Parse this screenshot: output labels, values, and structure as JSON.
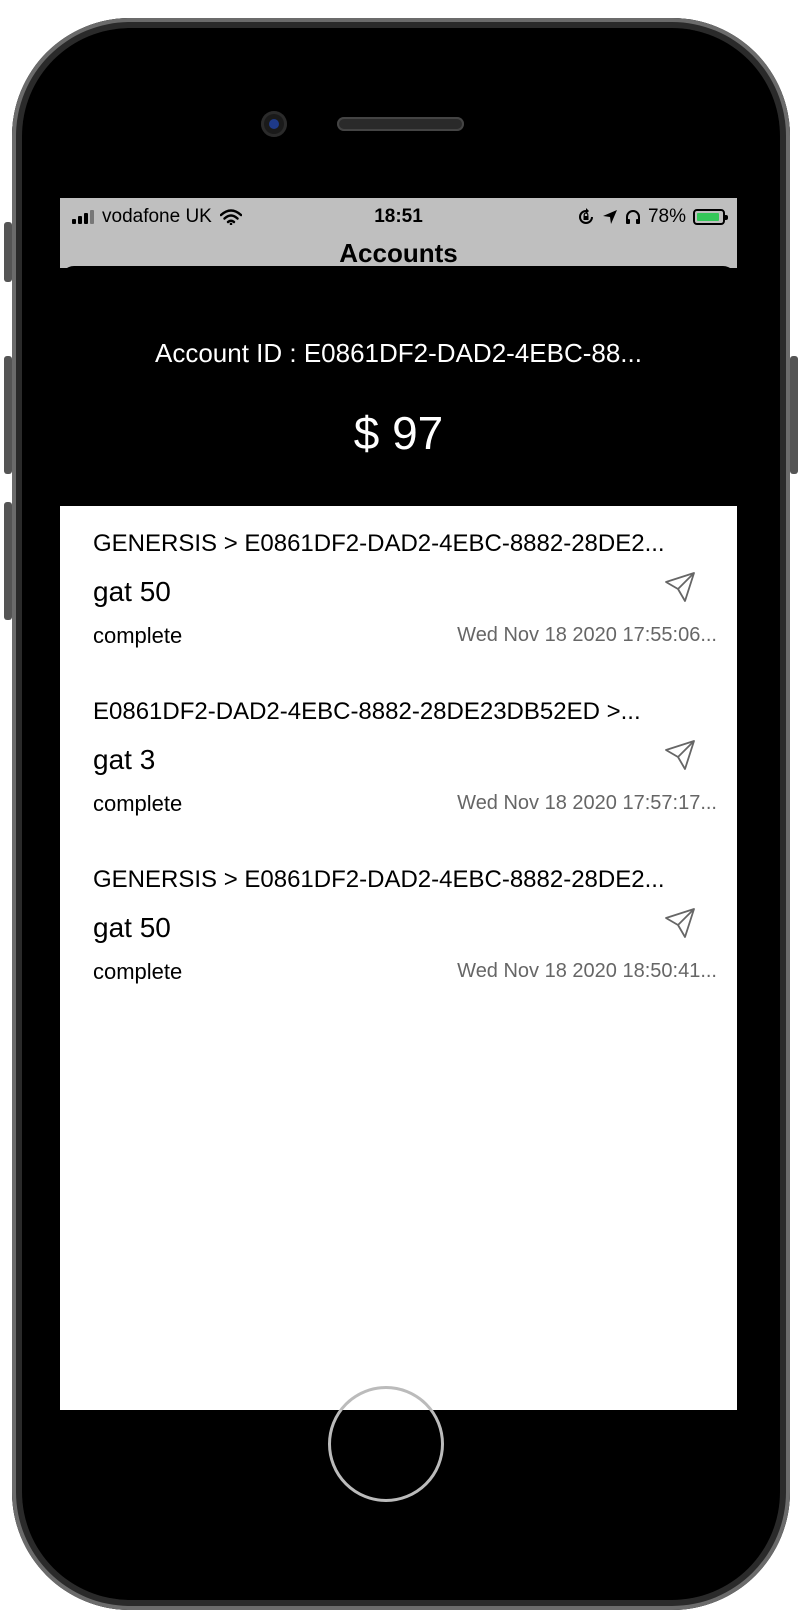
{
  "status_bar": {
    "carrier": "vodafone UK",
    "time": "18:51",
    "battery_percent": "78%",
    "battery_level": 0.78
  },
  "nav": {
    "title_peek": "Accounts"
  },
  "account": {
    "id_label": "Account ID : E0861DF2-DAD2-4EBC-88...",
    "balance": "$ 97"
  },
  "transactions": [
    {
      "route": "GENERSIS > E0861DF2-DAD2-4EBC-8882-28DE2...",
      "name": "gat 50",
      "status": "complete",
      "date": "Wed Nov 18 2020 17:55:06..."
    },
    {
      "route": "E0861DF2-DAD2-4EBC-8882-28DE23DB52ED >...",
      "name": "gat 3",
      "status": "complete",
      "date": "Wed Nov 18 2020 17:57:17..."
    },
    {
      "route": "GENERSIS > E0861DF2-DAD2-4EBC-8882-28DE2...",
      "name": "gat 50",
      "status": "complete",
      "date": "Wed Nov 18 2020 18:50:41..."
    }
  ],
  "icons": {
    "transaction": "send-arrow-icon",
    "wifi": "wifi-icon",
    "signal": "signal-bars-icon",
    "orientation_lock": "orientation-lock-icon",
    "location": "location-arrow-icon",
    "headphones": "headphones-icon",
    "battery": "battery-charging-icon"
  },
  "colors": {
    "battery_fill": "#34c759",
    "sheet_bg": "#000000",
    "list_bg": "#ffffff"
  }
}
